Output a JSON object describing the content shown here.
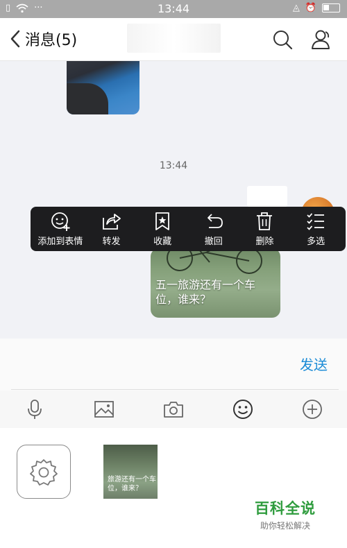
{
  "status_bar": {
    "time": "13:44",
    "dots": "···"
  },
  "header": {
    "back_label": "消息(5)"
  },
  "chat": {
    "timestamp": "13:44",
    "image_caption": "五一旅游还有一个车位，谁来？"
  },
  "context_menu": {
    "items": [
      {
        "label": "添加到表情",
        "icon": "add-emoji-icon"
      },
      {
        "label": "转发",
        "icon": "forward-icon"
      },
      {
        "label": "收藏",
        "icon": "bookmark-icon"
      },
      {
        "label": "撤回",
        "icon": "undo-icon"
      },
      {
        "label": "删除",
        "icon": "trash-icon"
      },
      {
        "label": "多选",
        "icon": "multi-select-icon"
      }
    ]
  },
  "input": {
    "send_label": "发送"
  },
  "toolbar": {
    "items": [
      "mic-icon",
      "image-icon",
      "camera-icon",
      "emoji-icon",
      "plus-icon"
    ]
  },
  "panel": {
    "thumb_caption": "旅游还有一个车位，谁来？"
  },
  "watermark": {
    "title": "百科全说",
    "subtitle": "助你轻松解决"
  },
  "colors": {
    "accent": "#1b8bd6",
    "menu_bg": "#1d1d1f",
    "watermark": "#2f9c3e"
  }
}
